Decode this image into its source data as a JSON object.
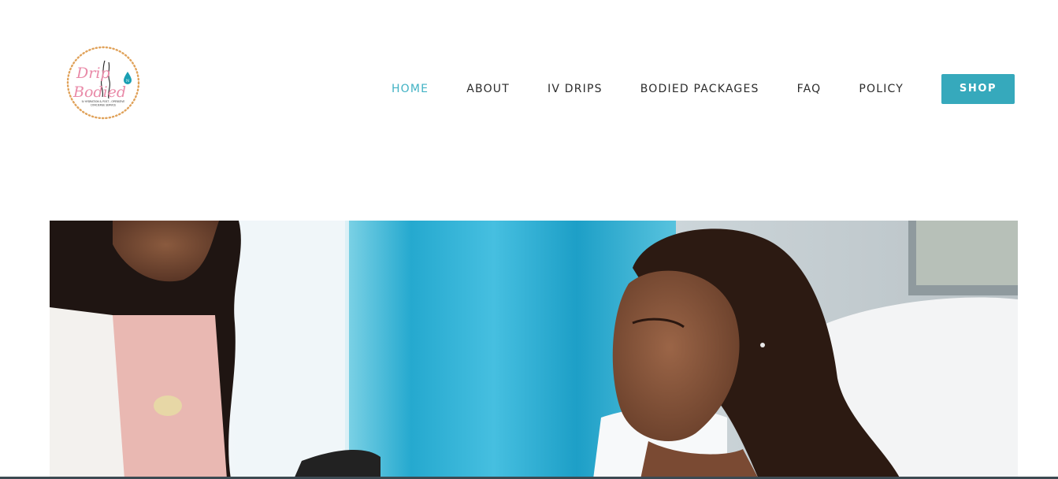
{
  "brand": {
    "logo_text_top": "Drip",
    "logo_text_bottom": "Bodied",
    "logo_connector": "N",
    "tagline_line1": "IV HYDRATION & POST - OPERATIVE",
    "tagline_line2": "CONCIERGE SERVICE"
  },
  "nav": {
    "items": [
      {
        "label": "HOME",
        "active": true
      },
      {
        "label": "ABOUT",
        "active": false
      },
      {
        "label": "IV DRIPS",
        "active": false
      },
      {
        "label": "BODIED PACKAGES",
        "active": false
      },
      {
        "label": "FAQ",
        "active": false
      },
      {
        "label": "POLICY",
        "active": false
      }
    ],
    "shop_label": "SHOP"
  },
  "colors": {
    "accent": "#41b2c4",
    "button": "#36a9bc",
    "logo_pink": "#e98aa8",
    "logo_dots": "#e0a25a"
  },
  "hero": {
    "image": "hero-photo"
  }
}
